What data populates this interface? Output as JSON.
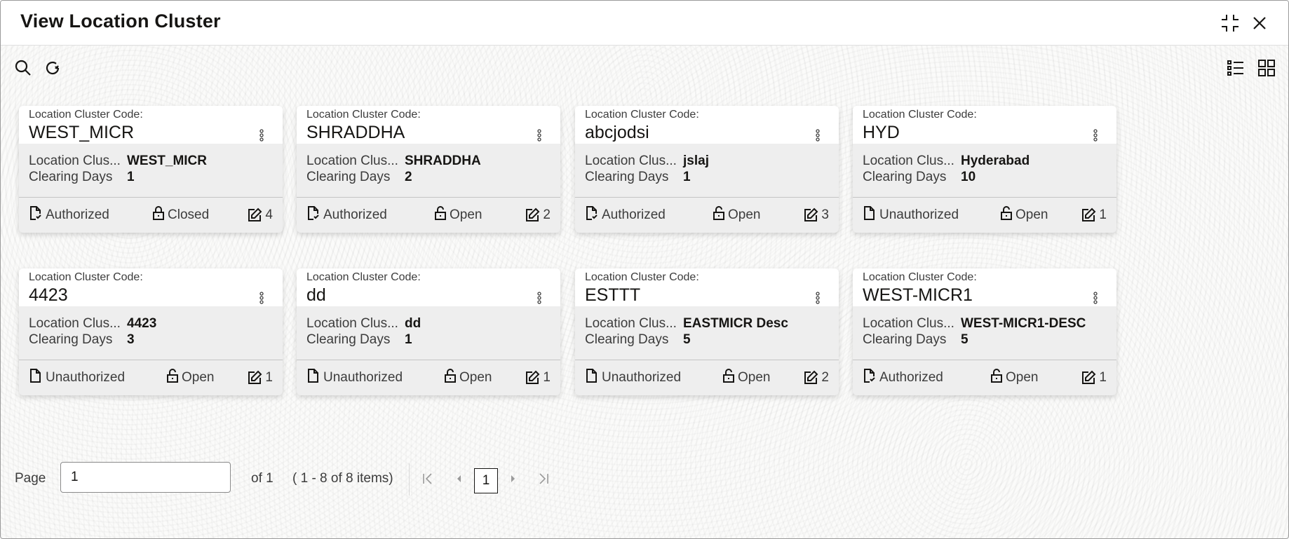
{
  "window": {
    "title": "View Location Cluster",
    "icons": {
      "minimize": "compress-icon",
      "close": "close-icon"
    }
  },
  "toolbar": {
    "left_icons": [
      "search-icon",
      "refresh-icon"
    ],
    "right_icons": [
      "list-view-icon",
      "grid-view-icon"
    ]
  },
  "card_labels": {
    "code_label": "Location Cluster Code:",
    "desc_label": "Location Clus...",
    "days_label": "Clearing Days"
  },
  "cards": [
    {
      "code": "WEST_MICR",
      "description": "WEST_MICR",
      "clearing_days": "1",
      "auth_status": "Authorized",
      "record_status": "Closed",
      "modifications": "4"
    },
    {
      "code": "SHRADDHA",
      "description": "SHRADDHA",
      "clearing_days": "2",
      "auth_status": "Authorized",
      "record_status": "Open",
      "modifications": "2"
    },
    {
      "code": "abcjodsi",
      "description": "jslaj",
      "clearing_days": "1",
      "auth_status": "Authorized",
      "record_status": "Open",
      "modifications": "3"
    },
    {
      "code": "HYD",
      "description": "Hyderabad",
      "clearing_days": "10",
      "auth_status": "Unauthorized",
      "record_status": "Open",
      "modifications": "1"
    },
    {
      "code": "4423",
      "description": "4423",
      "clearing_days": "3",
      "auth_status": "Unauthorized",
      "record_status": "Open",
      "modifications": "1"
    },
    {
      "code": "dd",
      "description": "dd",
      "clearing_days": "1",
      "auth_status": "Unauthorized",
      "record_status": "Open",
      "modifications": "1"
    },
    {
      "code": "ESTTT",
      "description": "EASTMICR Desc",
      "clearing_days": "5",
      "auth_status": "Unauthorized",
      "record_status": "Open",
      "modifications": "2"
    },
    {
      "code": "WEST-MICR1",
      "description": "WEST-MICR1-DESC",
      "clearing_days": "5",
      "auth_status": "Authorized",
      "record_status": "Open",
      "modifications": "1"
    }
  ],
  "pagination": {
    "page_label": "Page",
    "page_value": "1",
    "of_label": "of 1",
    "range_label": "( 1 - 8 of 8 items)",
    "current_page": "1"
  }
}
